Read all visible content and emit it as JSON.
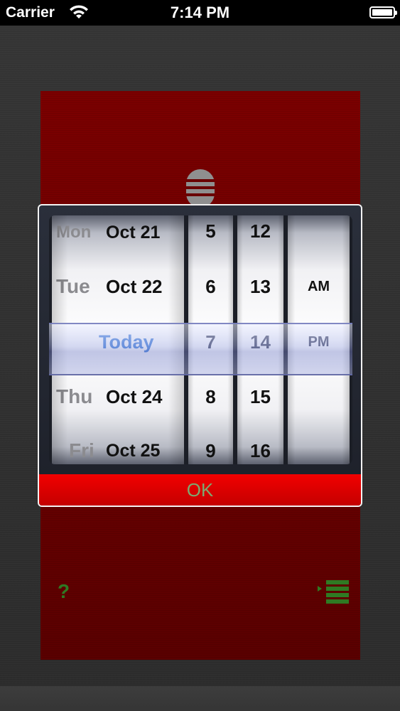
{
  "status_bar": {
    "carrier": "Carrier",
    "time": "7:14 PM",
    "icons": [
      "wifi-icon",
      "battery-icon"
    ]
  },
  "picker": {
    "date_wheel": [
      {
        "day": "Mon",
        "date": "Oct 21"
      },
      {
        "day": "Tue",
        "date": "Oct 22"
      },
      {
        "label": "Today",
        "selected": true
      },
      {
        "day": "Thu",
        "date": "Oct 24"
      },
      {
        "day": "Fri",
        "date": "Oct 25"
      }
    ],
    "hour_wheel": [
      "5",
      "6",
      "7",
      "8",
      "9"
    ],
    "minute_wheel": [
      "12",
      "13",
      "14",
      "15",
      "16"
    ],
    "ampm_wheel": [
      "AM",
      "PM"
    ],
    "selected": {
      "date": "Today",
      "hour": "7",
      "minute": "14",
      "period": "PM"
    },
    "ok_label": "OK"
  },
  "toolbar": {
    "help_label": "?",
    "icons": [
      "microphone-icon",
      "help-icon",
      "list-menu-icon"
    ]
  },
  "colors": {
    "panel_red": "#6c0000",
    "ok_red": "#e00000",
    "ok_text": "#7ea86f",
    "today_blue": "#3d7bd9",
    "icon_green": "#2f7a23"
  }
}
